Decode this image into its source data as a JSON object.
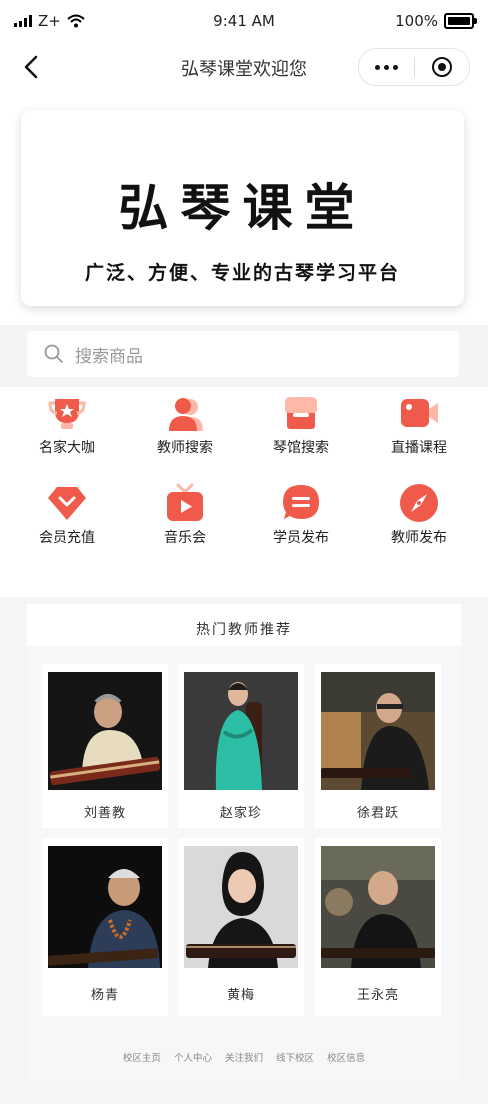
{
  "status": {
    "carrier": "Z+",
    "time": "9:41 AM",
    "battery": "100%"
  },
  "navbar": {
    "title": "弘琴课堂欢迎您"
  },
  "banner": {
    "brand": "弘琴课堂",
    "slogan": "广泛、方便、专业的古琴学习平台"
  },
  "search": {
    "placeholder": "搜索商品"
  },
  "menu": [
    {
      "label": "名家大咖",
      "icon": "trophy-icon"
    },
    {
      "label": "教师搜索",
      "icon": "user-icon"
    },
    {
      "label": "琴馆搜索",
      "icon": "shop-icon"
    },
    {
      "label": "直播课程",
      "icon": "video-camera-icon"
    },
    {
      "label": "会员充值",
      "icon": "diamond-icon"
    },
    {
      "label": "音乐会",
      "icon": "tv-play-icon"
    },
    {
      "label": "学员发布",
      "icon": "chat-icon"
    },
    {
      "label": "教师发布",
      "icon": "compass-icon"
    }
  ],
  "teachers": {
    "heading": "热门教师推荐",
    "items": [
      {
        "name": "刘善教"
      },
      {
        "name": "赵家珍"
      },
      {
        "name": "徐君跃"
      },
      {
        "name": "杨青"
      },
      {
        "name": "黄梅"
      },
      {
        "name": "王永亮"
      }
    ]
  },
  "footer": {
    "links": [
      "校区主页",
      "个人中心",
      "关注我们",
      "线下校区",
      "校区信息"
    ]
  },
  "colors": {
    "accent": "#f05a4a",
    "accent_light": "#ffb7a8"
  }
}
